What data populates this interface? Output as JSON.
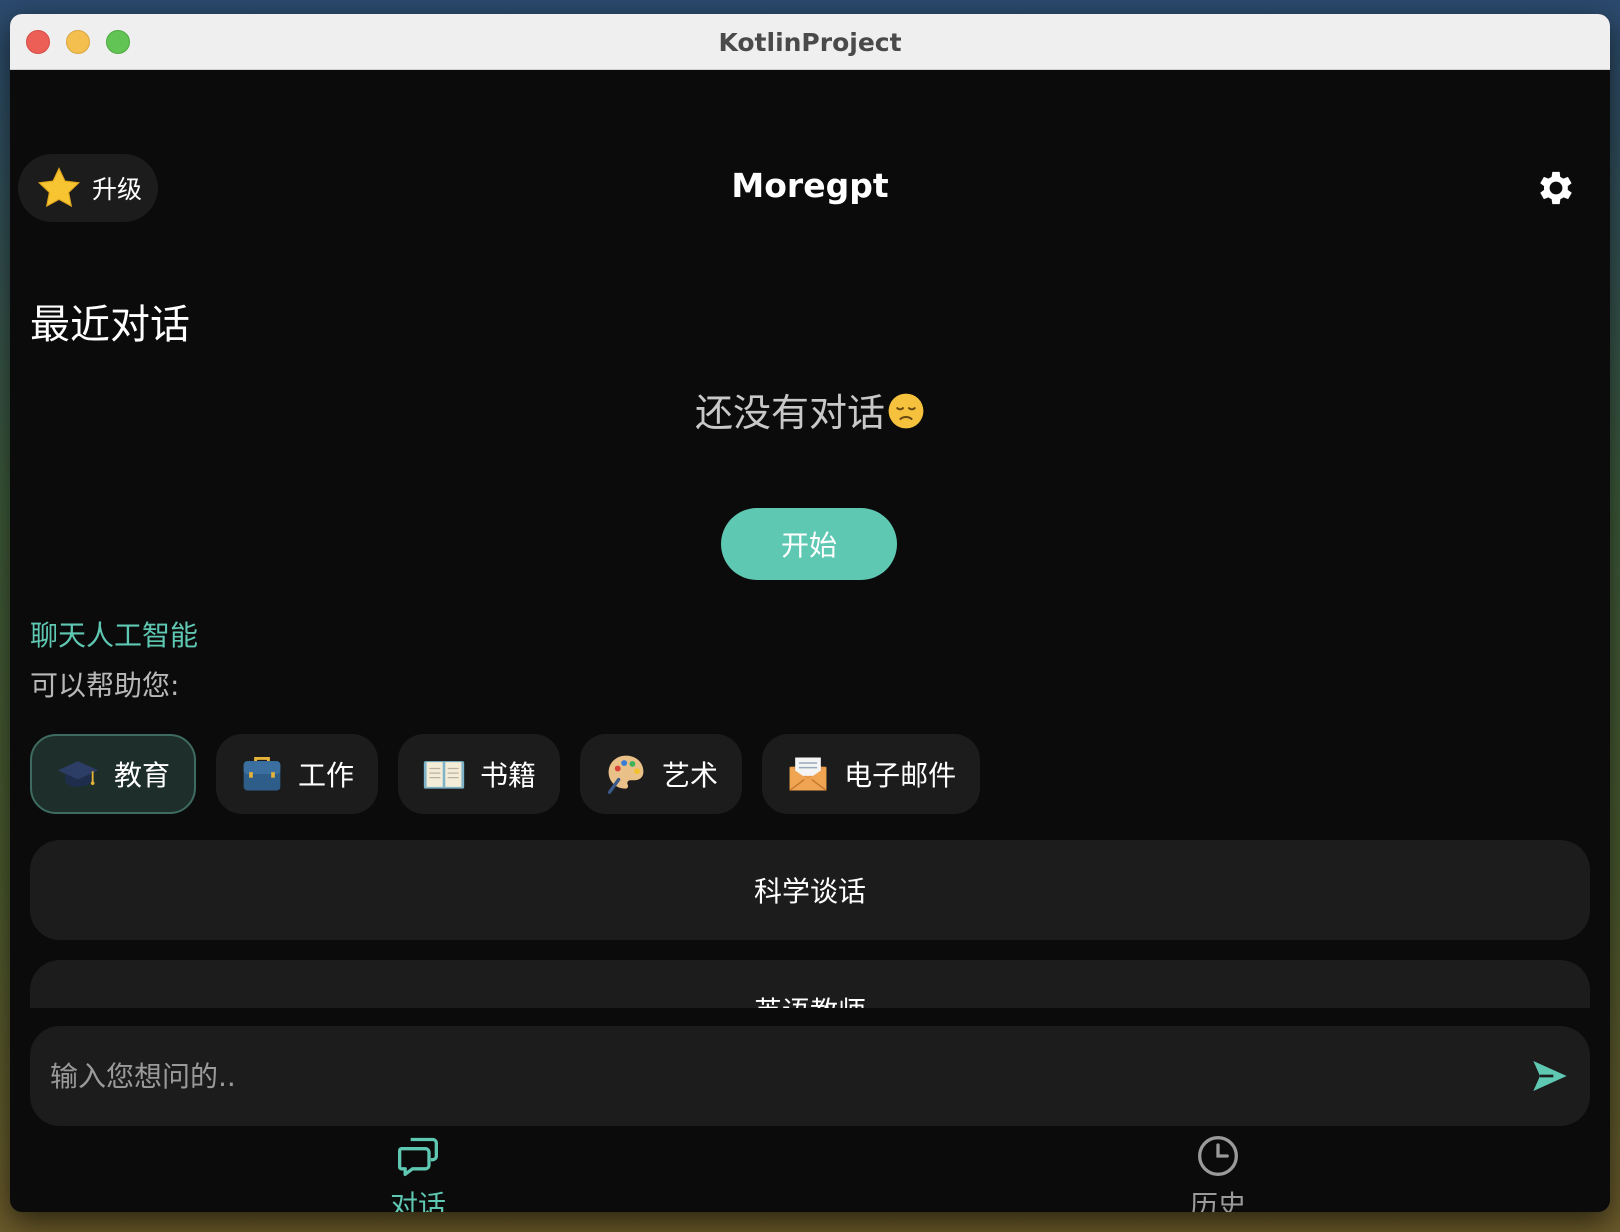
{
  "window": {
    "title": "KotlinProject"
  },
  "header": {
    "upgrade_label": "升级",
    "app_title": "Moregpt"
  },
  "recent": {
    "heading": "最近对话",
    "empty_text": "还没有对话",
    "start_label": "开始"
  },
  "assistant": {
    "title": "聊天人工智能",
    "subtitle": "可以帮助您:"
  },
  "categories": [
    {
      "label": "教育",
      "icon": "graduation-cap-icon",
      "active": true
    },
    {
      "label": "工作",
      "icon": "briefcase-icon",
      "active": false
    },
    {
      "label": "书籍",
      "icon": "open-book-icon",
      "active": false
    },
    {
      "label": "艺术",
      "icon": "palette-icon",
      "active": false
    },
    {
      "label": "电子邮件",
      "icon": "envelope-icon",
      "active": false
    }
  ],
  "prompts": [
    "科学谈话",
    "英语教师"
  ],
  "input": {
    "placeholder": "输入您想问的.."
  },
  "nav": {
    "chat_label": "对话",
    "history_label": "历史"
  },
  "colors": {
    "accent": "#5fc8b3",
    "background": "#0b0b0b",
    "card": "#1c1c1c"
  }
}
